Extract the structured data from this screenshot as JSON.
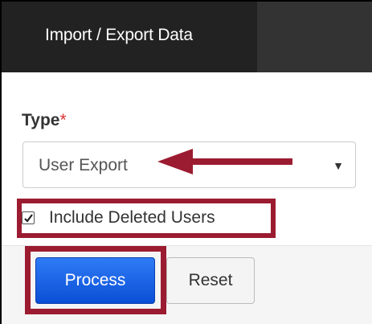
{
  "header": {
    "tab_label": "Import / Export Data"
  },
  "form": {
    "type_label": "Type",
    "required_marker": "*",
    "type_select": {
      "selected": "User Export",
      "caret_icon": "chevron-down-icon"
    },
    "include_deleted": {
      "label": "Include Deleted Users",
      "checked": true
    }
  },
  "actions": {
    "process_label": "Process",
    "reset_label": "Reset"
  },
  "annotations": {
    "highlight_color": "#9b1b30",
    "arrow_color": "#9b1b30"
  }
}
